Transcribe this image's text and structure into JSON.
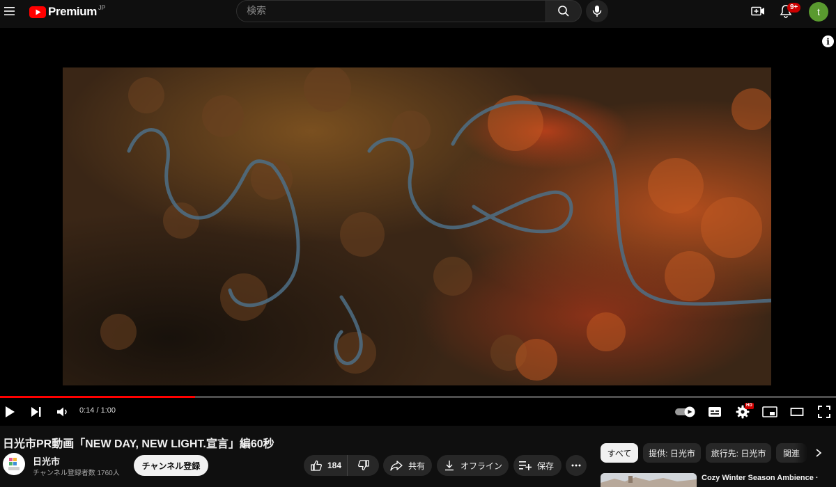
{
  "header": {
    "logo_text": "Premium",
    "logo_region": "JP",
    "search_placeholder": "検索",
    "notification_badge": "9+",
    "avatar_letter": "t"
  },
  "player": {
    "current_time": "0:14",
    "duration": "1:00",
    "time_display": "0:14 / 1:00",
    "progress_fraction": 0.233,
    "hd_badge": "HD",
    "info_glyph": "i"
  },
  "video": {
    "title": "日光市PR動画「NEW DAY, NEW LIGHT.宣言」編60秒",
    "channel_name": "日光市",
    "subscriber_count": "チャンネル登録者数 1760人",
    "subscribe_label": "チャンネル登録",
    "like_count": "184",
    "share_label": "共有",
    "offline_label": "オフライン",
    "save_label": "保存"
  },
  "chips": [
    {
      "label": "すべて",
      "selected": true
    },
    {
      "label": "提供: 日光市",
      "selected": false
    },
    {
      "label": "旅行先: 日光市",
      "selected": false
    },
    {
      "label": "関連",
      "selected": false
    }
  ],
  "recommendation": {
    "title": "Cozy Winter Season Ambience ·"
  },
  "colors": {
    "background": "#0f0f0f",
    "progress": "#ff0000",
    "brand_red": "#ff0000",
    "avatar_bg": "#5a9a2f"
  }
}
